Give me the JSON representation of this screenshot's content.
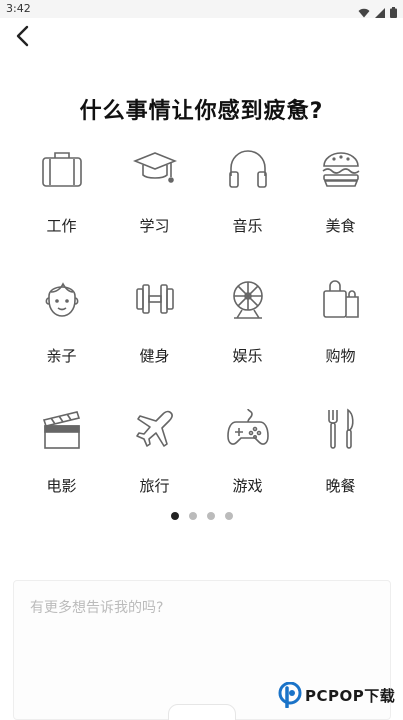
{
  "status_bar": {
    "time": "3:42"
  },
  "title": "什么事情让你感到疲惫?",
  "categories": [
    {
      "label": "工作",
      "icon": "briefcase-icon"
    },
    {
      "label": "学习",
      "icon": "graduation-cap-icon"
    },
    {
      "label": "音乐",
      "icon": "headphones-icon"
    },
    {
      "label": "美食",
      "icon": "burger-icon"
    },
    {
      "label": "亲子",
      "icon": "baby-face-icon"
    },
    {
      "label": "健身",
      "icon": "dumbbell-icon"
    },
    {
      "label": "娱乐",
      "icon": "ferris-wheel-icon"
    },
    {
      "label": "购物",
      "icon": "shopping-bags-icon"
    },
    {
      "label": "电影",
      "icon": "clapperboard-icon"
    },
    {
      "label": "旅行",
      "icon": "airplane-icon"
    },
    {
      "label": "游戏",
      "icon": "gamepad-icon"
    },
    {
      "label": "晚餐",
      "icon": "fork-knife-icon"
    }
  ],
  "pagination": {
    "total": 4,
    "active": 1
  },
  "note": {
    "placeholder": "有更多想告诉我的吗?",
    "value": ""
  },
  "watermark": {
    "text": "PCPOP下载"
  }
}
